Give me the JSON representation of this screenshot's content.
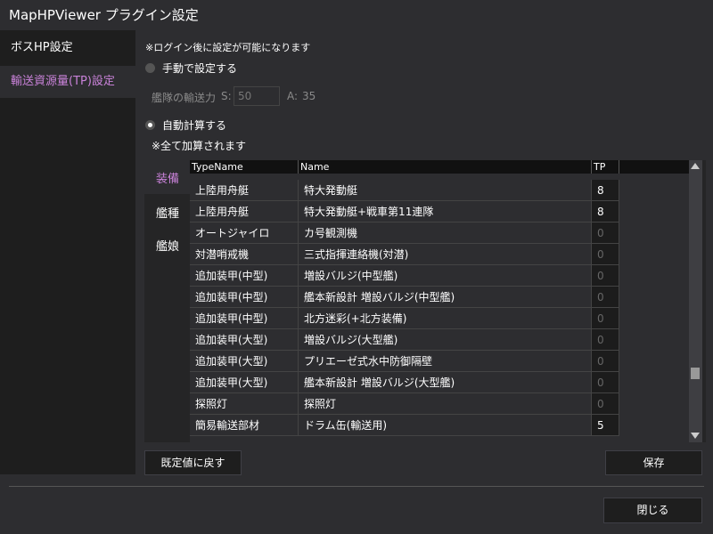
{
  "window": {
    "title": "MapHPViewer プラグイン設定"
  },
  "sidebar": {
    "items": [
      {
        "label": "ボスHP設定"
      },
      {
        "label": "輸送資源量(TP)設定"
      }
    ]
  },
  "notice": "※ログイン後に設定が可能になります",
  "manual": {
    "label": "手動で設定する",
    "fleet_label": "艦隊の輸送力",
    "s_label": "S:",
    "s_value": "50",
    "a_label": "A:",
    "a_value": "35"
  },
  "auto": {
    "label": "自動計算する",
    "note": "※全て加算されます"
  },
  "tabs": [
    {
      "label": "装備"
    },
    {
      "label": "艦種"
    },
    {
      "label": "艦娘"
    }
  ],
  "grid": {
    "columns": [
      "TypeName",
      "Name",
      "TP"
    ],
    "rows": [
      {
        "type": "上陸用舟艇",
        "name": "特大発動艇",
        "tp": "8"
      },
      {
        "type": "上陸用舟艇",
        "name": "特大発動艇+戦車第11連隊",
        "tp": "8"
      },
      {
        "type": "オートジャイロ",
        "name": "カ号観測機",
        "tp": "0"
      },
      {
        "type": "対潜哨戒機",
        "name": "三式指揮連絡機(対潜)",
        "tp": "0"
      },
      {
        "type": "追加装甲(中型)",
        "name": "増設バルジ(中型艦)",
        "tp": "0"
      },
      {
        "type": "追加装甲(中型)",
        "name": "艦本新設計 増設バルジ(中型艦)",
        "tp": "0"
      },
      {
        "type": "追加装甲(中型)",
        "name": "北方迷彩(+北方装備)",
        "tp": "0"
      },
      {
        "type": "追加装甲(大型)",
        "name": "増設バルジ(大型艦)",
        "tp": "0"
      },
      {
        "type": "追加装甲(大型)",
        "name": "プリエーゼ式水中防御隔壁",
        "tp": "0"
      },
      {
        "type": "追加装甲(大型)",
        "name": "艦本新設計 増設バルジ(大型艦)",
        "tp": "0"
      },
      {
        "type": "探照灯",
        "name": "探照灯",
        "tp": "0"
      },
      {
        "type": "簡易輸送部材",
        "name": "ドラム缶(輸送用)",
        "tp": "5"
      }
    ]
  },
  "buttons": {
    "reset": "既定値に戻す",
    "save": "保存",
    "close": "閉じる"
  },
  "colors": {
    "accent": "#c982d9",
    "background": "#2d2d30"
  }
}
